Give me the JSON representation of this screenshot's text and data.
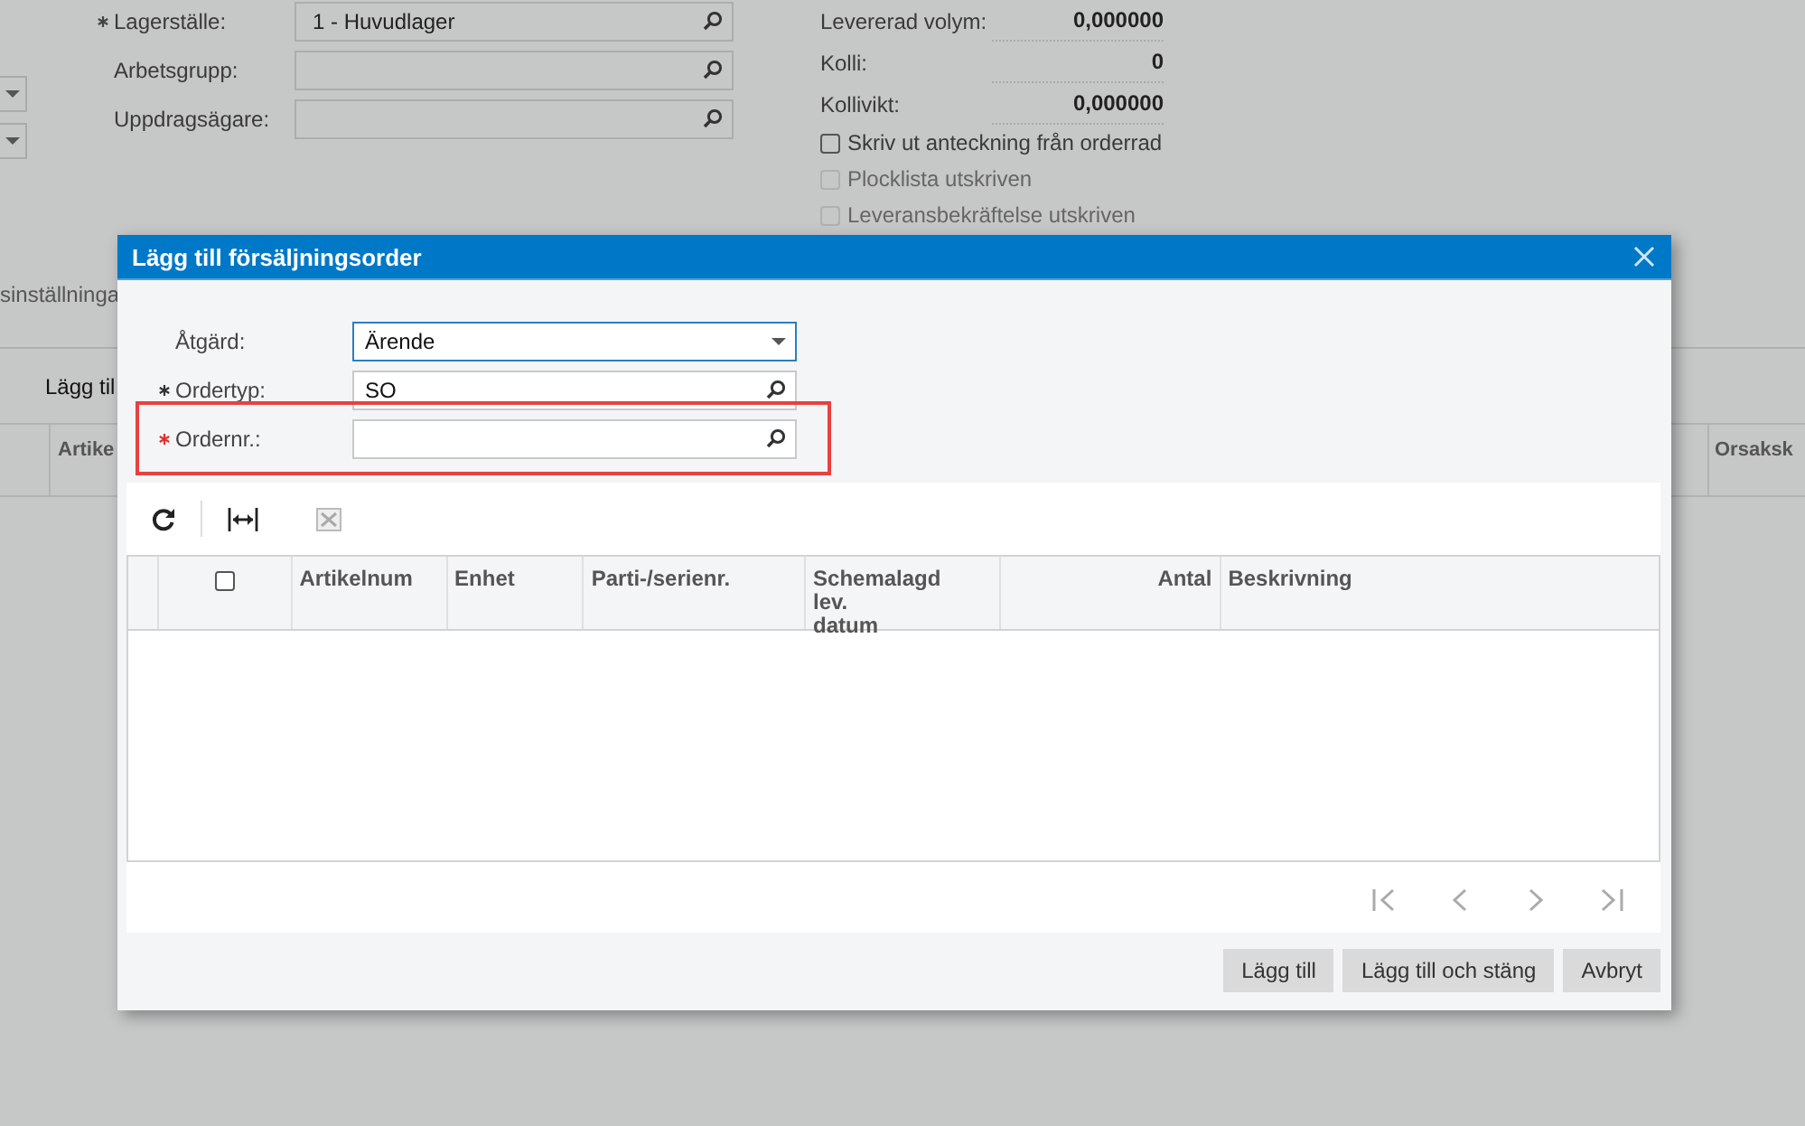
{
  "background": {
    "left_fields": [
      {
        "label": "Lagerställe:",
        "required": true,
        "value": "1 - Huvudlager"
      },
      {
        "label": "Arbetsgrupp:",
        "required": false
      },
      {
        "label": "Uppdragsägare:",
        "required": false
      }
    ],
    "right_values": [
      {
        "label": "Levererad volym:",
        "value": "0,000000"
      },
      {
        "label": "Kolli:",
        "value": "0"
      },
      {
        "label": "Kollivikt:",
        "value": "0,000000"
      }
    ],
    "checkboxes": [
      {
        "label": "Skriv ut anteckning från orderrad",
        "checked": false,
        "disabled": false
      },
      {
        "label": "Plocklista utskriven",
        "checked": false,
        "disabled": true
      },
      {
        "label": "Leveransbekräftelse utskriven",
        "checked": false,
        "disabled": true
      }
    ],
    "tab": "sinställninga",
    "toolbar_button": "Lägg til",
    "grid_columns": [
      "Artike",
      "Orsaksk"
    ]
  },
  "dialog": {
    "title": "Lägg till försäljningsorder",
    "fields": [
      {
        "label": "Åtgärd:",
        "kind": "dropdown",
        "required": false,
        "value": "Ärende",
        "highlighted": false
      },
      {
        "label": "Ordertyp:",
        "kind": "lookup",
        "required": true,
        "value": "SO",
        "highlighted": false
      },
      {
        "label": "Ordernr.:",
        "kind": "lookup",
        "required": true,
        "highlighted": true
      }
    ],
    "grid": {
      "select_all_checked": false,
      "columns": [
        {
          "label": "Artikelnum",
          "numeric": false
        },
        {
          "label": "Enhet",
          "numeric": false
        },
        {
          "label": "Parti-/serienr.",
          "numeric": false
        },
        {
          "label": "Schemalagd lev. datum",
          "numeric": false
        },
        {
          "label": "Antal",
          "numeric": true
        },
        {
          "label": "Beskrivning",
          "numeric": false
        }
      ]
    },
    "buttons": [
      "Lägg till",
      "Lägg till och stäng",
      "Avbryt"
    ]
  }
}
